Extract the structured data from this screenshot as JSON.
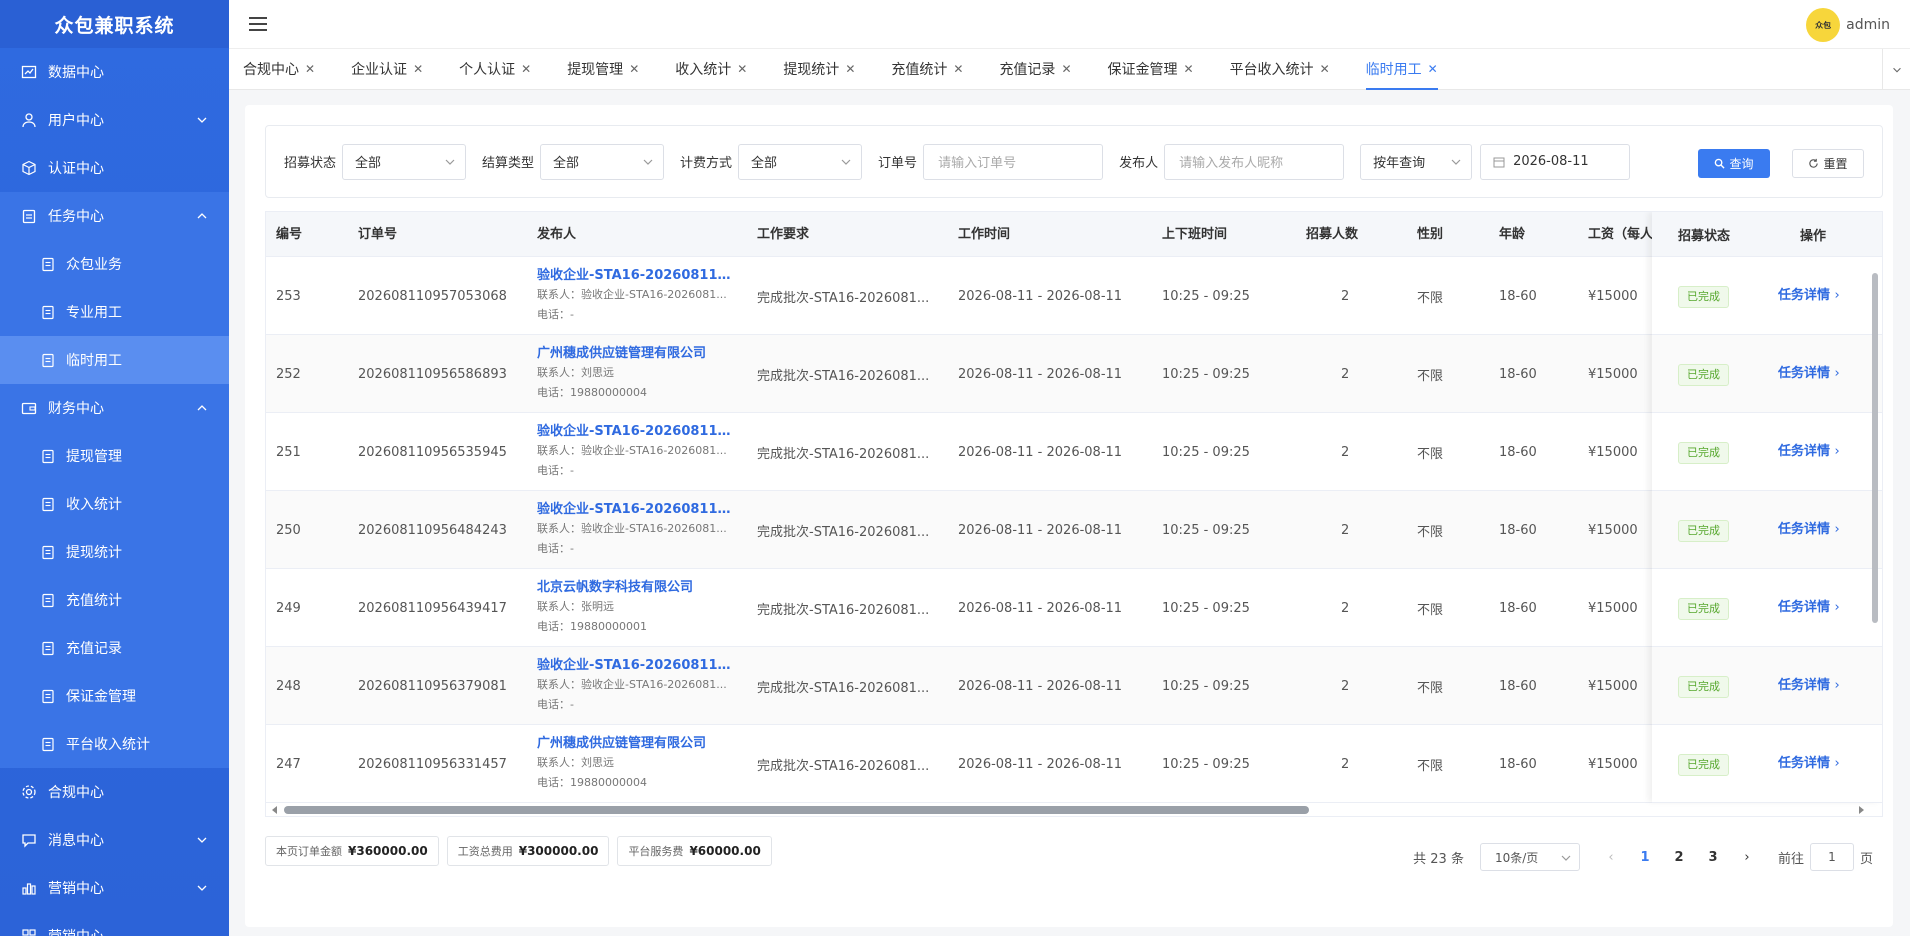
{
  "app": {
    "title": "众包兼职系统"
  },
  "topbar": {
    "username": "admin",
    "avatar_text": "众包"
  },
  "sidebar": {
    "items": [
      {
        "label": "数据中心",
        "icon": "chart-icon"
      },
      {
        "label": "用户中心",
        "icon": "user-icon"
      },
      {
        "label": "认证中心",
        "icon": "box-icon"
      },
      {
        "label": "任务中心",
        "icon": "clipboard-icon"
      },
      {
        "label": "众包业务"
      },
      {
        "label": "专业用工"
      },
      {
        "label": "临时用工"
      },
      {
        "label": "财务中心",
        "icon": "wallet-icon"
      },
      {
        "label": "提现管理"
      },
      {
        "label": "收入统计"
      },
      {
        "label": "提现统计"
      },
      {
        "label": "充值统计"
      },
      {
        "label": "充值记录"
      },
      {
        "label": "保证金管理"
      },
      {
        "label": "平台收入统计"
      },
      {
        "label": "合规中心",
        "icon": "gear-icon"
      },
      {
        "label": "消息中心",
        "icon": "message-icon"
      },
      {
        "label": "营销中心",
        "icon": "bar-icon"
      },
      {
        "label": "营销中心"
      }
    ]
  },
  "tabs": [
    {
      "label": "合规中心"
    },
    {
      "label": "企业认证"
    },
    {
      "label": "个人认证"
    },
    {
      "label": "提现管理"
    },
    {
      "label": "收入统计"
    },
    {
      "label": "提现统计"
    },
    {
      "label": "充值统计"
    },
    {
      "label": "充值记录"
    },
    {
      "label": "保证金管理"
    },
    {
      "label": "平台收入统计"
    },
    {
      "label": "临时用工"
    }
  ],
  "filter": {
    "status_label": "招募状态",
    "status_value": "全部",
    "settle_label": "结算类型",
    "settle_value": "全部",
    "fee_label": "计费方式",
    "fee_value": "全部",
    "order_label": "订单号",
    "order_placeholder": "请输入订单号",
    "publisher_label": "发布人",
    "publisher_placeholder": "请输入发布人昵称",
    "period_value": "按年查询",
    "date_value": "2026-08-11",
    "search_label": "查询",
    "reset_label": "重置"
  },
  "table": {
    "headers": [
      "编号",
      "订单号",
      "发布人",
      "工作要求",
      "工作时间",
      "上下班时间",
      "招募人数",
      "性别",
      "年龄",
      "工资（每人",
      "招募状态",
      "操作"
    ],
    "rows": [
      {
        "id": "253",
        "order": "202608110957053068",
        "pub_name": "验收企业-STA16-20260811-0...",
        "pub_contact": "联系人：验收企业-STA16-2026081...",
        "pub_phone": "电话：-",
        "req": "完成批次-STA16-2026081...",
        "date": "2026-08-11 - 2026-08-11",
        "time": "10:25 - 09:25",
        "count": "2",
        "gender": "不限",
        "age": "18-60",
        "wage": "¥15000",
        "status": "已完成",
        "action": "任务详情"
      },
      {
        "id": "252",
        "order": "202608110956586893",
        "pub_name": "广州穗成供应链管理有限公司",
        "pub_contact": "联系人：刘思远",
        "pub_phone": "电话：19880000004",
        "req": "完成批次-STA16-2026081...",
        "date": "2026-08-11 - 2026-08-11",
        "time": "10:25 - 09:25",
        "count": "2",
        "gender": "不限",
        "age": "18-60",
        "wage": "¥15000",
        "status": "已完成",
        "action": "任务详情"
      },
      {
        "id": "251",
        "order": "202608110956535945",
        "pub_name": "验收企业-STA16-20260811-0...",
        "pub_contact": "联系人：验收企业-STA16-2026081...",
        "pub_phone": "电话：-",
        "req": "完成批次-STA16-2026081...",
        "date": "2026-08-11 - 2026-08-11",
        "time": "10:25 - 09:25",
        "count": "2",
        "gender": "不限",
        "age": "18-60",
        "wage": "¥15000",
        "status": "已完成",
        "action": "任务详情"
      },
      {
        "id": "250",
        "order": "202608110956484243",
        "pub_name": "验收企业-STA16-20260811-0...",
        "pub_contact": "联系人：验收企业-STA16-2026081...",
        "pub_phone": "电话：-",
        "req": "完成批次-STA16-2026081...",
        "date": "2026-08-11 - 2026-08-11",
        "time": "10:25 - 09:25",
        "count": "2",
        "gender": "不限",
        "age": "18-60",
        "wage": "¥15000",
        "status": "已完成",
        "action": "任务详情"
      },
      {
        "id": "249",
        "order": "202608110956439417",
        "pub_name": "北京云帆数字科技有限公司",
        "pub_contact": "联系人：张明远",
        "pub_phone": "电话：19880000001",
        "req": "完成批次-STA16-2026081...",
        "date": "2026-08-11 - 2026-08-11",
        "time": "10:25 - 09:25",
        "count": "2",
        "gender": "不限",
        "age": "18-60",
        "wage": "¥15000",
        "status": "已完成",
        "action": "任务详情"
      },
      {
        "id": "248",
        "order": "202608110956379081",
        "pub_name": "验收企业-STA16-20260811-0...",
        "pub_contact": "联系人：验收企业-STA16-2026081...",
        "pub_phone": "电话：-",
        "req": "完成批次-STA16-2026081...",
        "date": "2026-08-11 - 2026-08-11",
        "time": "10:25 - 09:25",
        "count": "2",
        "gender": "不限",
        "age": "18-60",
        "wage": "¥15000",
        "status": "已完成",
        "action": "任务详情"
      },
      {
        "id": "247",
        "order": "202608110956331457",
        "pub_name": "广州穗成供应链管理有限公司",
        "pub_contact": "联系人：刘思远",
        "pub_phone": "电话：19880000004",
        "req": "完成批次-STA16-2026081...",
        "date": "2026-08-11 - 2026-08-11",
        "time": "10:25 - 09:25",
        "count": "2",
        "gender": "不限",
        "age": "18-60",
        "wage": "¥15000",
        "status": "已完成",
        "action": "任务详情"
      }
    ]
  },
  "stats": {
    "page_amount_label": "本页订单金额",
    "page_amount": "¥360000.00",
    "wage_total_label": "工资总费用",
    "wage_total": "¥300000.00",
    "service_fee_label": "平台服务费",
    "service_fee": "¥60000.00"
  },
  "pager": {
    "total": "共 23 条",
    "page_size": "10条/页",
    "pages": [
      "1",
      "2",
      "3"
    ],
    "goto_prefix": "前往",
    "goto_value": "1",
    "goto_suffix": "页"
  },
  "colors": {
    "primary": "#3a7bf0",
    "sidebar": "#2f6ae0",
    "success": "#57a82e"
  }
}
